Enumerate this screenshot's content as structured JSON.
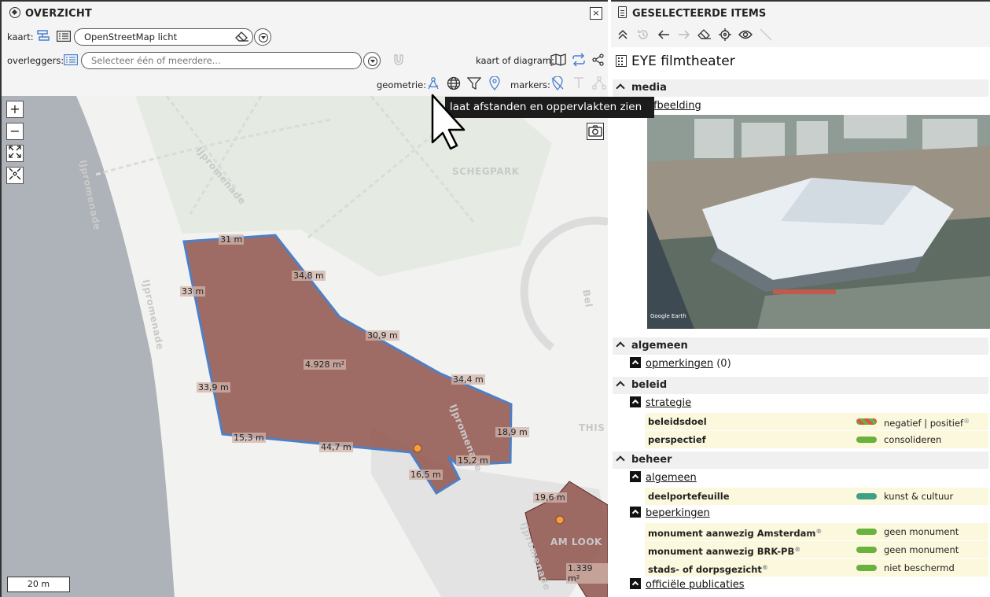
{
  "left_panel": {
    "title": "OVERZICHT",
    "close_label": "×",
    "kaart_label": "kaart:",
    "basemap_value": "OpenStreetMap licht",
    "overleggers_label": "overleggers:",
    "overlay_placeholder": "Selecteer één of meerdere...",
    "kaart_of_diagram_label": "kaart of diagram:",
    "geometrie_label": "geometrie:",
    "markers_label": "markers:",
    "tooltip": "laat afstanden en oppervlakten zien",
    "zoom_in": "+",
    "zoom_out": "−",
    "scale": "20 m"
  },
  "map": {
    "streets": [
      "IJpromenade",
      "IJpromenade",
      "IJpromenade",
      "IJpromenade",
      "IJpromenade"
    ],
    "park_label": "SCHEGPARK",
    "partial_labels": [
      "THIS I",
      "Bel",
      "AM LOOK"
    ],
    "measurements": [
      "31 m",
      "34,8 m",
      "33 m",
      "30,9 m",
      "4.928 m²",
      "34,4 m",
      "33,9 m",
      "18,9 m",
      "15,3 m",
      "44,7 m",
      "15,2 m",
      "16,5 m",
      "19,6 m",
      "1.339 m²"
    ],
    "colors": {
      "polygon_fill": "#8a4a42",
      "polygon_stroke": "#4f7fc4",
      "marker": "#f0a040"
    }
  },
  "right_panel": {
    "title": "GESELECTEERDE ITEMS",
    "item_title": "EYE filmtheater",
    "sections": {
      "media": "media",
      "media_link": "afbeelding",
      "algemeen": "algemeen",
      "opmerkingen": "opmerkingen",
      "opmerkingen_count": "(0)",
      "beleid": "beleid",
      "strategie": "strategie",
      "beheer": "beheer",
      "beheer_algemeen": "algemeen",
      "beperkingen": "beperkingen",
      "officiele_publicaties": "officiële publicaties"
    },
    "props": {
      "beleidsdoel_k": "beleidsdoel",
      "beleidsdoel_v": "negatief | positief",
      "perspectief_k": "perspectief",
      "perspectief_v": "consolideren",
      "deelportefeuille_k": "deelportefeuille",
      "deelportefeuille_v": "kunst & cultuur",
      "monument_ams_k": "monument aanwezig Amsterdam",
      "monument_ams_v": "geen monument",
      "monument_brk_k": "monument aanwezig BRK-PB",
      "monument_brk_v": "geen monument",
      "stads_k": "stads- of dorpsgezicht",
      "stads_v": "niet beschermd"
    },
    "photo_caption": "Google Earth",
    "colors": {
      "green": "#6ab23e",
      "teal": "#3fa088",
      "section_bg": "#f0f0f0",
      "prop_bg": "#fbf8dd"
    }
  }
}
